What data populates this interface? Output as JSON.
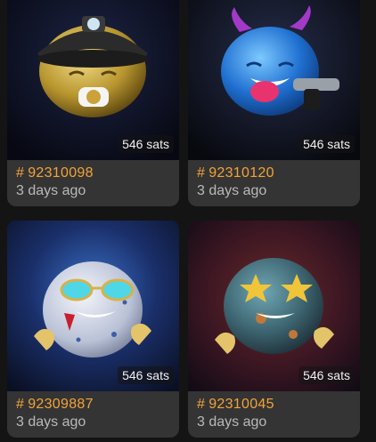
{
  "cards": [
    {
      "id": "92310098",
      "age": "3 days ago",
      "price": "546 sats",
      "character": "gold-miner-moon"
    },
    {
      "id": "92310120",
      "age": "3 days ago",
      "price": "546 sats",
      "character": "blue-devil-moon"
    },
    {
      "id": "92309887",
      "age": "3 days ago",
      "price": "546 sats",
      "character": "speckled-sunglasses-moon"
    },
    {
      "id": "92310045",
      "age": "3 days ago",
      "price": "546 sats",
      "character": "bronze-star-eyes-moon"
    }
  ],
  "hash_symbol": "#",
  "colors": {
    "accent": "#f2a33a",
    "card": "#343434",
    "page": "#141414"
  }
}
